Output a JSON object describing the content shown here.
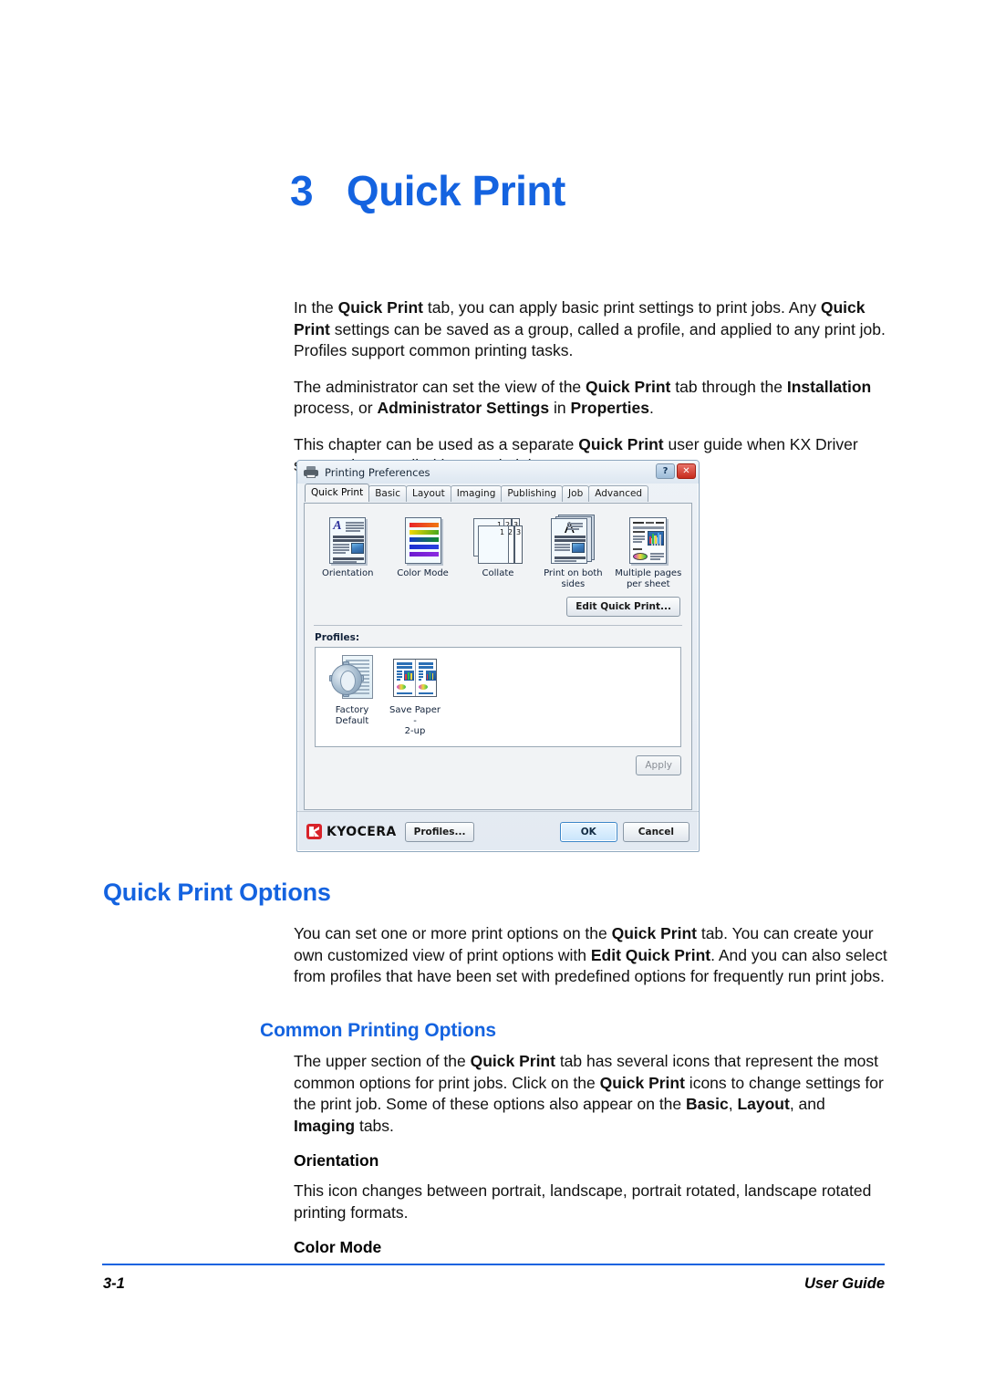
{
  "document": {
    "chapter_number": "3",
    "chapter_title": "Quick Print",
    "chapter_heading_full": "3   Quick Print"
  },
  "intro": {
    "paragraph_1": {
      "segments": [
        {
          "t": "In the ",
          "b": false
        },
        {
          "t": "Quick Print",
          "b": true
        },
        {
          "t": " tab, you can apply basic print settings to print jobs. Any ",
          "b": false
        },
        {
          "t": "Quick Print",
          "b": true
        },
        {
          "t": " settings can be saved as a group, called a profile, and applied to any print job. Profiles support common printing tasks.",
          "b": false
        }
      ]
    },
    "paragraph_2": {
      "segments": [
        {
          "t": "The administrator can set the view of the ",
          "b": false
        },
        {
          "t": "Quick Print",
          "b": true
        },
        {
          "t": " tab through the ",
          "b": false
        },
        {
          "t": "Installation",
          "b": true
        },
        {
          "t": " process, or ",
          "b": false
        },
        {
          "t": "Administrator Settings",
          "b": true
        },
        {
          "t": " in ",
          "b": false
        },
        {
          "t": "Properties",
          "b": true
        },
        {
          "t": ".",
          "b": false
        }
      ]
    },
    "paragraph_3": {
      "segments": [
        {
          "t": "This chapter can be used as a separate ",
          "b": false
        },
        {
          "t": "Quick Print",
          "b": true
        },
        {
          "t": " user guide when KX Driver support is controlled by an administrator.",
          "b": false
        }
      ]
    }
  },
  "dialog": {
    "window_title": "Printing Preferences",
    "titlebar_icon": "printer-icon",
    "help_button": "?",
    "close_button": "✕",
    "tabs": [
      {
        "label": "Quick Print",
        "active": true
      },
      {
        "label": "Basic",
        "active": false
      },
      {
        "label": "Layout",
        "active": false
      },
      {
        "label": "Imaging",
        "active": false
      },
      {
        "label": "Publishing",
        "active": false
      },
      {
        "label": "Job",
        "active": false
      },
      {
        "label": "Advanced",
        "active": false
      }
    ],
    "icons": [
      {
        "label": "Orientation",
        "icon": "page-letter-a-icon"
      },
      {
        "label": "Color Mode",
        "icon": "color-bars-icon"
      },
      {
        "label": "Collate",
        "icon": "collated-pages-icon"
      },
      {
        "label": "Print on both\nsides",
        "label_line1": "Print on both",
        "label_line2": "sides",
        "icon": "duplex-pages-icon"
      },
      {
        "label": "Multiple pages\nper sheet",
        "label_line1": "Multiple pages",
        "label_line2": "per sheet",
        "icon": "multi-page-sheet-icon"
      }
    ],
    "edit_quick_print_button": "Edit Quick Print...",
    "profiles_label": "Profiles:",
    "profiles": [
      {
        "label_line1": "Factory",
        "label_line2": "Default",
        "icon": "gear-page-icon"
      },
      {
        "label_line1": "Save Paper -",
        "label_line2": "2-up",
        "icon": "two-up-page-icon"
      }
    ],
    "apply_button": "Apply",
    "brand_name": "KYOCERA",
    "profiles_button": "Profiles...",
    "ok_button": "OK",
    "cancel_button": "Cancel",
    "collate_numbers": [
      "1",
      "2",
      "3",
      "1",
      "2",
      "3"
    ],
    "colors": {
      "accent_blue": "#1463e0",
      "brand_red": "#d8232a",
      "ok_border": "#3c87c9"
    }
  },
  "section_quick_print_options": {
    "heading": "Quick Print Options",
    "paragraph": {
      "segments": [
        {
          "t": "You can set one or more print options on the ",
          "b": false
        },
        {
          "t": "Quick Print",
          "b": true
        },
        {
          "t": " tab. You can create your own customized view of print options with ",
          "b": false
        },
        {
          "t": "Edit Quick Print",
          "b": true
        },
        {
          "t": ". And you can also select from profiles that have been set with predefined options for frequently run print jobs.",
          "b": false
        }
      ]
    }
  },
  "section_common_printing_options": {
    "heading": "Common Printing Options",
    "paragraph": {
      "segments": [
        {
          "t": "The upper section of the ",
          "b": false
        },
        {
          "t": "Quick Print",
          "b": true
        },
        {
          "t": " tab has several icons that represent the most common options for print jobs. Click on the ",
          "b": false
        },
        {
          "t": "Quick Print",
          "b": true
        },
        {
          "t": " icons to change settings for the print job. Some of these options also appear on the ",
          "b": false
        },
        {
          "t": "Basic",
          "b": true
        },
        {
          "t": ", ",
          "b": false
        },
        {
          "t": "Layout",
          "b": true
        },
        {
          "t": ", and ",
          "b": false
        },
        {
          "t": "Imaging",
          "b": true
        },
        {
          "t": " tabs.",
          "b": false
        }
      ]
    },
    "subsections": [
      {
        "heading": "Orientation",
        "paragraph": {
          "segments": [
            {
              "t": "This icon changes between portrait, landscape, portrait rotated, landscape rotated printing formats.",
              "b": false
            }
          ]
        }
      },
      {
        "heading": "Color Mode",
        "paragraph": {
          "segments": []
        }
      }
    ]
  },
  "footer": {
    "page_number": "3-1",
    "guide_label": "User Guide"
  }
}
